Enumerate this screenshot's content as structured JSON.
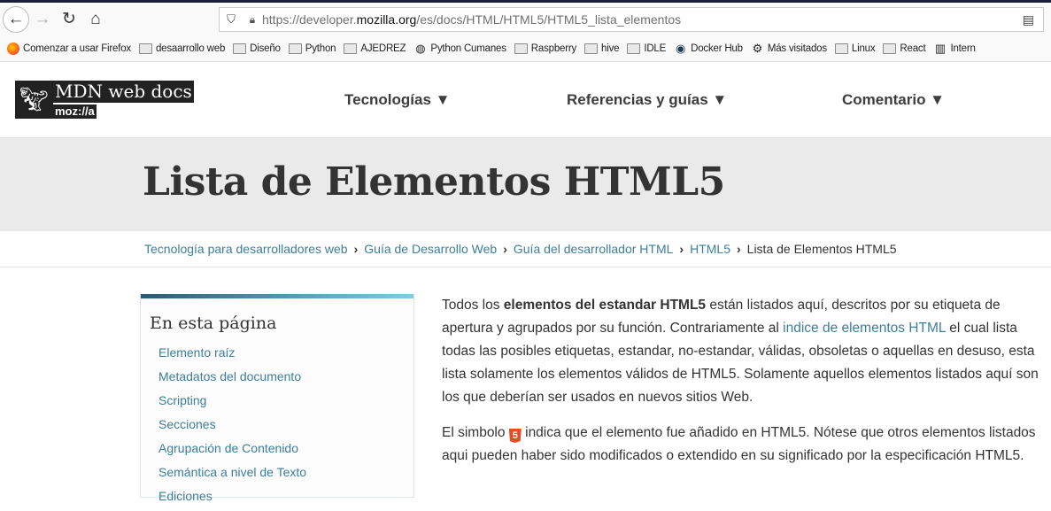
{
  "browser": {
    "url_prefix": "https://developer.",
    "url_domain": "mozilla.org",
    "url_path": "/es/docs/HTML/HTML5/HTML5_lista_elementos",
    "bookmarks": [
      {
        "label": "Comenzar a usar Firefox",
        "icon": "firefox-icon"
      },
      {
        "label": "desaarrollo web",
        "icon": "folder-icon"
      },
      {
        "label": "Diseño",
        "icon": "folder-icon"
      },
      {
        "label": "Python",
        "icon": "folder-icon"
      },
      {
        "label": "AJEDREZ",
        "icon": "folder-icon"
      },
      {
        "label": "Python Cumanes",
        "icon": "globe-icon"
      },
      {
        "label": "Raspberry",
        "icon": "folder-icon"
      },
      {
        "label": "hive",
        "icon": "folder-icon"
      },
      {
        "label": "IDLE",
        "icon": "folder-icon"
      },
      {
        "label": "Docker Hub",
        "icon": "docker-icon"
      },
      {
        "label": "Más visitados",
        "icon": "gear-icon"
      },
      {
        "label": "Linux",
        "icon": "folder-icon"
      },
      {
        "label": "React",
        "icon": "folder-icon"
      },
      {
        "label": "Intern",
        "icon": "archive-icon"
      }
    ]
  },
  "header": {
    "logo_text": "MDN web docs",
    "logo_sub": "moz://a",
    "nav": [
      "Tecnologías ▼",
      "Referencias y guías ▼",
      "Comentario ▼"
    ]
  },
  "page": {
    "title": "Lista de Elementos HTML5",
    "breadcrumbs": [
      "Tecnología para desarrolladores web",
      "Guía de Desarrollo Web",
      "Guía del desarrollador HTML",
      "HTML5",
      "Lista de Elementos HTML5"
    ]
  },
  "toc": {
    "heading": "En esta página",
    "items": [
      "Elemento raíz",
      "Metadatos del documento",
      "Scripting",
      "Secciones",
      "Agrupación de Contenido",
      "Semántica a nivel de Texto",
      "Ediciones"
    ]
  },
  "content": {
    "p1_a": "Todos los ",
    "p1_bold": "elementos del estandar HTML5",
    "p1_b": " están listados aquí, descritos por su etiqueta de apertura y agrupados por su función. Contrariamente al ",
    "p1_link": "indice de elementos HTML",
    "p1_c": " el cual lista todas las posibles etiquetas, estandar, no-estandar, válidas, obsoletas o aquellas en desuso, esta lista solamente los elementos válidos de HTML5. Solamente aquellos elementos listados aquí son los que deberían ser usados en nuevos sitios Web.",
    "p2_a": "El simbolo ",
    "p2_icon": "5",
    "p2_b": " indica que el elemento fue añadido en HTML5. Nótese que otros elementos listados aqui pueden haber sido modificados o extendido en su significado por la especificación HTML5."
  }
}
